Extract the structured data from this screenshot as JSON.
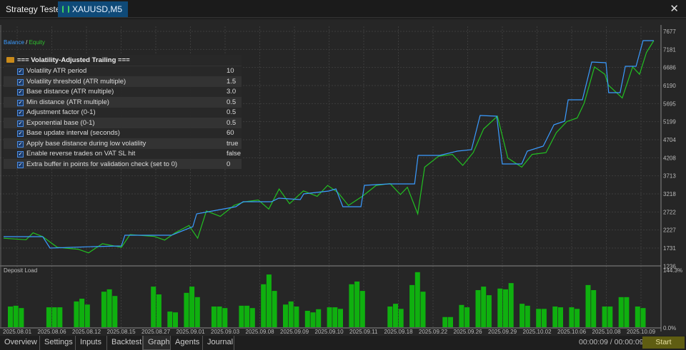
{
  "window": {
    "tab_title": "Strategy Tester",
    "symbol_tab": "XAUUSD,M5",
    "close_icon": "close-icon"
  },
  "legend": {
    "balance": "Balance",
    "sep": " / ",
    "equity": "Equity"
  },
  "params": {
    "group": "=== Volatility-Adjusted Trailing ===",
    "rows": [
      {
        "label": "Volatility ATR period",
        "value": "10"
      },
      {
        "label": "Volatility threshold (ATR multiple)",
        "value": "1.5"
      },
      {
        "label": "Base distance (ATR multiple)",
        "value": "3.0"
      },
      {
        "label": "Min distance (ATR multiple)",
        "value": "0.5"
      },
      {
        "label": "Adjustment factor (0-1)",
        "value": "0.5"
      },
      {
        "label": "Exponential base (0-1)",
        "value": "0.5"
      },
      {
        "label": "Base update interval (seconds)",
        "value": "60"
      },
      {
        "label": "Apply base distance during low volatility",
        "value": "true"
      },
      {
        "label": "Enable reverse trades on VAT SL hit",
        "value": "false"
      },
      {
        "label": "Extra buffer in points for validation check (set to 0)",
        "value": "0"
      }
    ]
  },
  "chart_data": [
    {
      "type": "line",
      "title": "",
      "colors": {
        "balance": "#3a9bff",
        "equity": "#22c022"
      },
      "yticks": [
        "7677",
        "7181",
        "6686",
        "6190",
        "5695",
        "5199",
        "4704",
        "4208",
        "3713",
        "3218",
        "2722",
        "2227",
        "1731",
        "1236"
      ],
      "ylim": [
        1236,
        7677
      ],
      "xticks": [
        "2025.08.01",
        "2025.08.06",
        "2025.08.12",
        "2025.08.15",
        "2025.08.27",
        "2025.09.01",
        "2025.09.03",
        "2025.09.08",
        "2025.09.09",
        "2025.09.10",
        "2025.09.11",
        "2025.09.18",
        "2025.09.22",
        "2025.09.26",
        "2025.09.29",
        "2025.10.02",
        "2025.10.06",
        "2025.10.08",
        "2025.10.09"
      ],
      "grid": true,
      "series": [
        {
          "name": "Balance",
          "points": [
            [
              -0.35,
              2044
            ],
            [
              0.78,
              2044
            ],
            [
              0.99,
              1731
            ],
            [
              2.23,
              1770
            ],
            [
              3.05,
              1790
            ],
            [
              3.15,
              2083
            ],
            [
              4.49,
              2083
            ],
            [
              5.11,
              2318
            ],
            [
              5.22,
              2670
            ],
            [
              6.35,
              2865
            ],
            [
              6.56,
              3002
            ],
            [
              7.38,
              3002
            ],
            [
              7.59,
              3100
            ],
            [
              8.21,
              3061
            ],
            [
              8.31,
              3217
            ],
            [
              9.03,
              3295
            ],
            [
              9.24,
              3354
            ],
            [
              9.44,
              2865
            ],
            [
              9.96,
              2865
            ],
            [
              10.06,
              3452
            ],
            [
              10.78,
              3491
            ],
            [
              11.51,
              3491
            ],
            [
              11.61,
              4274
            ],
            [
              12.23,
              4274
            ],
            [
              12.74,
              4391
            ],
            [
              13.15,
              4430
            ],
            [
              13.4,
              5369
            ],
            [
              13.88,
              5349
            ],
            [
              14.04,
              4039
            ],
            [
              14.6,
              4039
            ],
            [
              14.76,
              4391
            ],
            [
              15.22,
              4528
            ],
            [
              15.53,
              5115
            ],
            [
              15.84,
              5213
            ],
            [
              15.94,
              5799
            ],
            [
              16.35,
              5799
            ],
            [
              16.62,
              6836
            ],
            [
              17.03,
              6816
            ],
            [
              17.11,
              5995
            ],
            [
              17.44,
              5995
            ],
            [
              17.59,
              6719
            ],
            [
              17.9,
              6719
            ],
            [
              18.1,
              7423
            ],
            [
              18.41,
              7423
            ]
          ]
        },
        {
          "name": "Equity",
          "points": [
            [
              -0.35,
              2000
            ],
            [
              0.3,
              1960
            ],
            [
              0.5,
              2150
            ],
            [
              0.78,
              2044
            ],
            [
              1.2,
              1750
            ],
            [
              1.8,
              1700
            ],
            [
              2.1,
              1600
            ],
            [
              2.5,
              1850
            ],
            [
              3.05,
              1750
            ],
            [
              3.3,
              2100
            ],
            [
              4.0,
              2050
            ],
            [
              4.3,
              1950
            ],
            [
              4.6,
              2150
            ],
            [
              5.0,
              2350
            ],
            [
              5.25,
              2000
            ],
            [
              5.5,
              2750
            ],
            [
              5.9,
              2600
            ],
            [
              6.3,
              2900
            ],
            [
              6.6,
              3000
            ],
            [
              7.0,
              3050
            ],
            [
              7.3,
              2800
            ],
            [
              7.6,
              3350
            ],
            [
              7.9,
              2950
            ],
            [
              8.3,
              3300
            ],
            [
              8.7,
              3150
            ],
            [
              9.0,
              3450
            ],
            [
              9.3,
              3250
            ],
            [
              9.6,
              2900
            ],
            [
              10.0,
              3150
            ],
            [
              10.4,
              3450
            ],
            [
              10.8,
              3500
            ],
            [
              11.1,
              3200
            ],
            [
              11.3,
              3400
            ],
            [
              11.6,
              2670
            ],
            [
              11.8,
              3950
            ],
            [
              12.2,
              4250
            ],
            [
              12.6,
              4300
            ],
            [
              12.9,
              4000
            ],
            [
              13.2,
              4350
            ],
            [
              13.5,
              5000
            ],
            [
              13.9,
              5350
            ],
            [
              14.2,
              4200
            ],
            [
              14.6,
              3950
            ],
            [
              14.9,
              4300
            ],
            [
              15.3,
              4350
            ],
            [
              15.6,
              4900
            ],
            [
              15.9,
              5200
            ],
            [
              16.2,
              5300
            ],
            [
              16.4,
              5700
            ],
            [
              16.7,
              6700
            ],
            [
              17.0,
              6500
            ],
            [
              17.1,
              6200
            ],
            [
              17.5,
              5850
            ],
            [
              17.8,
              6700
            ],
            [
              18.0,
              6500
            ],
            [
              18.2,
              7100
            ],
            [
              18.41,
              7423
            ]
          ]
        }
      ]
    },
    {
      "type": "bar",
      "title": "Deposit Load",
      "color": "#0fb00f",
      "ylim": [
        0,
        144.3
      ],
      "yticks": [
        "144.3%",
        "0.0%"
      ],
      "bars": [
        [
          0,
          53
        ],
        [
          1,
          55
        ],
        [
          2,
          49
        ],
        [
          7,
          51
        ],
        [
          8,
          51
        ],
        [
          9,
          51
        ],
        [
          12,
          66
        ],
        [
          13,
          73
        ],
        [
          14,
          58
        ],
        [
          17,
          91
        ],
        [
          18,
          97
        ],
        [
          19,
          80
        ],
        [
          26,
          104
        ],
        [
          27,
          84
        ],
        [
          29,
          40
        ],
        [
          30,
          38
        ],
        [
          32,
          88
        ],
        [
          33,
          104
        ],
        [
          34,
          77
        ],
        [
          37,
          53
        ],
        [
          38,
          53
        ],
        [
          39,
          49
        ],
        [
          42,
          55
        ],
        [
          43,
          55
        ],
        [
          44,
          49
        ],
        [
          46,
          110
        ],
        [
          47,
          135
        ],
        [
          48,
          93
        ],
        [
          50,
          58
        ],
        [
          51,
          66
        ],
        [
          52,
          53
        ],
        [
          54,
          42
        ],
        [
          55,
          38
        ],
        [
          56,
          46
        ],
        [
          58,
          51
        ],
        [
          59,
          51
        ],
        [
          60,
          47
        ],
        [
          62,
          110
        ],
        [
          63,
          117
        ],
        [
          64,
          93
        ],
        [
          69,
          53
        ],
        [
          70,
          60
        ],
        [
          71,
          47
        ],
        [
          73,
          108
        ],
        [
          74,
          141
        ],
        [
          75,
          91
        ],
        [
          79,
          26
        ],
        [
          80,
          26
        ],
        [
          82,
          57
        ],
        [
          83,
          51
        ],
        [
          85,
          95
        ],
        [
          86,
          104
        ],
        [
          87,
          82
        ],
        [
          89,
          99
        ],
        [
          90,
          97
        ],
        [
          91,
          113
        ],
        [
          93,
          60
        ],
        [
          94,
          55
        ],
        [
          96,
          47
        ],
        [
          97,
          47
        ],
        [
          99,
          53
        ],
        [
          100,
          51
        ],
        [
          102,
          51
        ],
        [
          103,
          47
        ],
        [
          105,
          108
        ],
        [
          106,
          95
        ],
        [
          108,
          53
        ],
        [
          109,
          53
        ],
        [
          111,
          77
        ],
        [
          112,
          77
        ],
        [
          114,
          53
        ],
        [
          115,
          49
        ]
      ]
    }
  ],
  "bottom": {
    "tabs": [
      "Overview",
      "Settings",
      "Inputs",
      "Backtest",
      "Graph",
      "Agents",
      "Journal"
    ],
    "active": "Graph",
    "timer": "00:00:09 / 00:00:09",
    "start": "Start"
  }
}
